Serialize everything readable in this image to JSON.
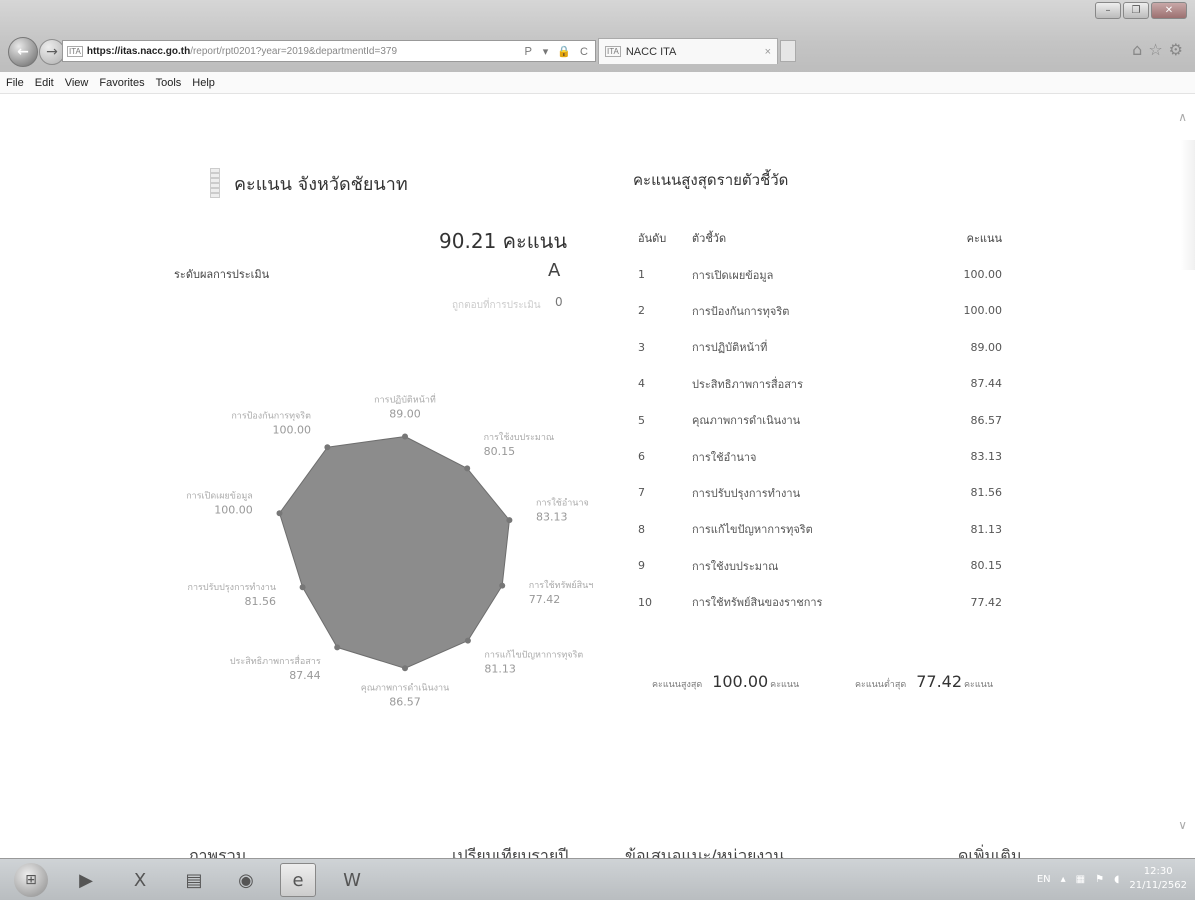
{
  "browser": {
    "url_favicon": "ITA",
    "url_protocol": "https://",
    "url_host": "itas.nacc.go.th",
    "url_path": "/report/rpt0201?year=2019&departmentId=379",
    "url_tools": "Ｐ ▾ 🔒 C",
    "tab_favicon": "ITA",
    "tab_title": "NACC ITA",
    "tab_close": "×",
    "window_controls": {
      "minimize": "–",
      "maximize": "❐",
      "close": "✕"
    },
    "right_icons": [
      "home-icon",
      "star-icon",
      "gear-icon"
    ]
  },
  "menu": [
    "File",
    "Edit",
    "View",
    "Favorites",
    "Tools",
    "Help"
  ],
  "left_panel": {
    "title": "คะแนน จังหวัดชัยนาท",
    "score_text": "90.21 คะแนน",
    "level_label": "ระดับผลการประเมิน",
    "level_value": "A",
    "faint_label": "ถูกตอบที่การประเมิน",
    "faint_value": "0"
  },
  "chart_data": {
    "type": "radar",
    "max": 100,
    "colors": {
      "fill": "#8c8c8c",
      "stroke": "#6e6e6e",
      "point": "#777777"
    },
    "axes": [
      {
        "label": "การปฏิบัติหน้าที่",
        "value": 89.0,
        "value_text": "89.00"
      },
      {
        "label": "การใช้งบประมาณ",
        "value": 80.15,
        "value_text": "80.15"
      },
      {
        "label": "การใช้อำนาจ",
        "value": 83.13,
        "value_text": "83.13"
      },
      {
        "label": "การใช้ทรัพย์สินฯ",
        "value": 77.42,
        "value_text": "77.42"
      },
      {
        "label": "การแก้ไขปัญหาการทุจริต",
        "value": 81.13,
        "value_text": "81.13"
      },
      {
        "label": "คุณภาพการดำเนินงาน",
        "value": 86.57,
        "value_text": "86.57"
      },
      {
        "label": "ประสิทธิภาพการสื่อสาร",
        "value": 87.44,
        "value_text": "87.44"
      },
      {
        "label": "การปรับปรุงการทำงาน",
        "value": 81.56,
        "value_text": "81.56"
      },
      {
        "label": "การเปิดเผยข้อมูล",
        "value": 100.0,
        "value_text": "100.00"
      },
      {
        "label": "การป้องกันการทุจริต",
        "value": 100.0,
        "value_text": "100.00"
      }
    ]
  },
  "right_panel": {
    "title": "คะแนนสูงสุดรายตัวชี้วัด",
    "headers": {
      "rank": "อันดับ",
      "indicator": "ตัวชี้วัด",
      "score": "คะแนน"
    },
    "rows": [
      {
        "rank": "1",
        "indicator": "การเปิดเผยข้อมูล",
        "score": "100.00"
      },
      {
        "rank": "2",
        "indicator": "การป้องกันการทุจริต",
        "score": "100.00"
      },
      {
        "rank": "3",
        "indicator": "การปฏิบัติหน้าที่",
        "score": "89.00"
      },
      {
        "rank": "4",
        "indicator": "ประสิทธิภาพการสื่อสาร",
        "score": "87.44"
      },
      {
        "rank": "5",
        "indicator": "คุณภาพการดำเนินงาน",
        "score": "86.57"
      },
      {
        "rank": "6",
        "indicator": "การใช้อำนาจ",
        "score": "83.13"
      },
      {
        "rank": "7",
        "indicator": "การปรับปรุงการทำงาน",
        "score": "81.56"
      },
      {
        "rank": "8",
        "indicator": "การแก้ไขปัญหาการทุจริต",
        "score": "81.13"
      },
      {
        "rank": "9",
        "indicator": "การใช้งบประมาณ",
        "score": "80.15"
      },
      {
        "rank": "10",
        "indicator": "การใช้ทรัพย์สินของราชการ",
        "score": "77.42"
      }
    ],
    "max_label": "คะแนนสูงสุด",
    "max_value": "100.00",
    "max_unit": "คะแนน",
    "min_label": "คะแนนต่ำสุด",
    "min_value": "77.42",
    "min_unit": "คะแนน"
  },
  "footer_nav": [
    "ภาพรวม",
    "เปรียบเทียบรายปี",
    "ข้อเสนอแนะ/หน่วยงาน",
    "ดูเพิ่มเติม"
  ],
  "taskbar": {
    "items": [
      "windows-start-icon",
      "media-player-icon",
      "excel-icon",
      "files-icon",
      "chrome-icon",
      "ie-icon",
      "word-icon"
    ],
    "lang": "EN",
    "time": "12:30",
    "date": "21/11/2562"
  }
}
